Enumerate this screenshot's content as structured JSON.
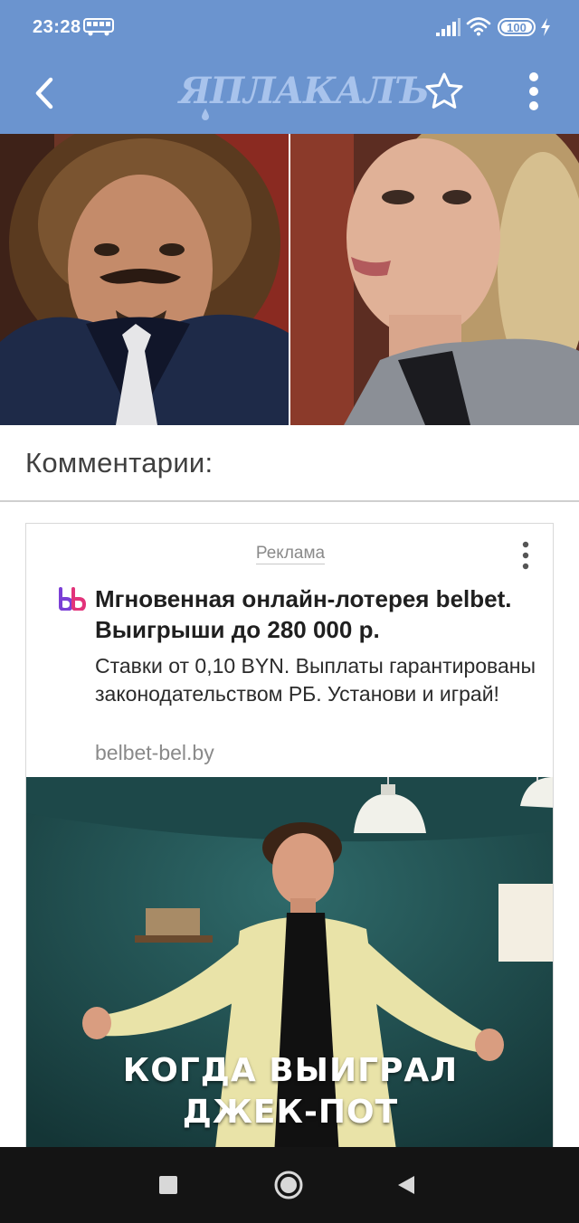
{
  "status_bar": {
    "time": "23:28",
    "battery_text": "100",
    "battery_level": 1.0,
    "icons": [
      "bus-icon",
      "signal-icon",
      "wifi-icon",
      "battery-icon",
      "charging-icon"
    ]
  },
  "toolbar": {
    "logo_text": "ЯПЛАКАЛЪ",
    "icons": [
      "back-arrow-icon",
      "star-outline-icon",
      "more-vertical-icon"
    ]
  },
  "post": {
    "image_description_icon": "photo-collage"
  },
  "comments": {
    "title": "Комментарии:"
  },
  "ad": {
    "label": "Реклама",
    "title": "Мгновенная онлайн-лотерея belbet. Выигрыши до 280 000 р.",
    "body": "Ставки от 0,10 BYN. Выплаты гарантированы законодательством РБ. Установи и играй!",
    "domain": "belbet-bel.by",
    "caption_line1": "КОГДА ВЫИГРАЛ",
    "caption_line2": "ДЖЕК-ПОТ"
  },
  "nav_bar": {
    "icons": [
      "recent-apps-icon",
      "home-icon",
      "back-icon"
    ]
  },
  "colors": {
    "toolbar": "#6b94cf",
    "logo": "#a8c3ec",
    "ad_brand": "#7b3fd6"
  }
}
